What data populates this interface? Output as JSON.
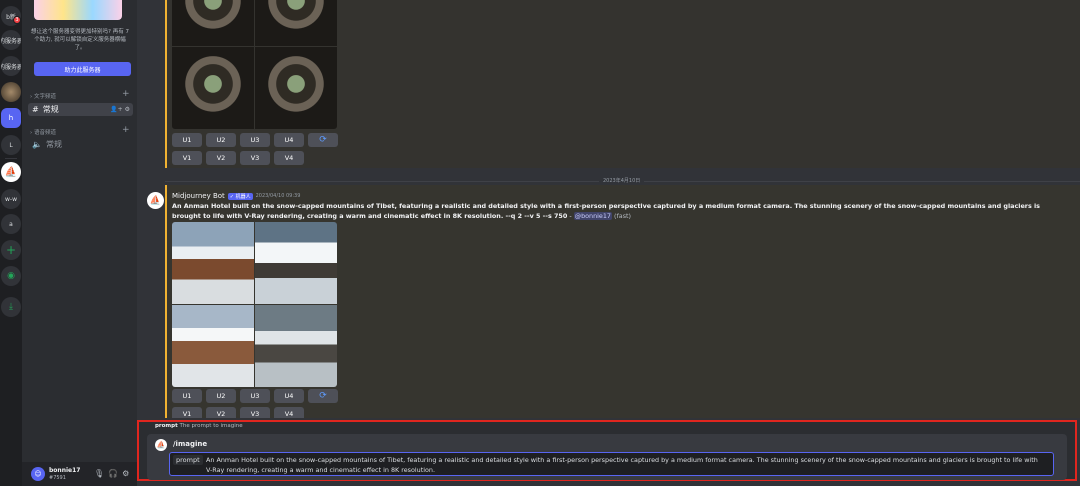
{
  "rail": {
    "servers": [
      "b新",
      "的服务器",
      "的服务器",
      "",
      "h",
      "L",
      "",
      "w-w",
      "a"
    ],
    "badge_count": "3",
    "add_icon": "+",
    "explore_icon": "◉",
    "download_icon": "⤓"
  },
  "sidebar": {
    "banner_text": "想让这个服务器变得更加特别吗? 再有 7 个助力, 就可以解锁自定义服务器横幅了。",
    "boost_button": "助力此服务器",
    "text_category": "文字频道",
    "voice_category": "语音频道",
    "text_channel": "常规",
    "voice_channel": "常规",
    "user": {
      "name": "bonnie17",
      "tag": "#7591"
    }
  },
  "first_message": {
    "upscale_buttons": [
      "U1",
      "U2",
      "U3",
      "U4"
    ],
    "variation_buttons": [
      "V1",
      "V2",
      "V3",
      "V4"
    ],
    "reroll_icon": "⟳"
  },
  "date_divider": "2023年4月10日",
  "bot_message": {
    "author": "Midjourney Bot",
    "bot_tag": "✓ 机器人",
    "timestamp": "2023/04/10 09:39",
    "prompt_bold": "An Anman Hotel built on the snow-capped mountains of Tibet, featuring a realistic and detailed style with a first-person perspective captured by a medium format camera. The stunning scenery of the snow-capped mountains and glaciers is brought to life with V-Ray rendering, creating a warm and cinematic effect in 8K resolution. --q 2 --v 5 --s 750",
    "separator": " - ",
    "mention": "@bonnie17",
    "mode": "(fast)",
    "upscale_buttons": [
      "U1",
      "U2",
      "U3",
      "U4"
    ],
    "variation_buttons": [
      "V1",
      "V2",
      "V3",
      "V4"
    ]
  },
  "command": {
    "hint_label": "prompt",
    "hint_text": "The prompt to imagine",
    "name": "/imagine",
    "field_label": "prompt",
    "field_value": "An Anman Hotel built on the snow-capped mountains of Tibet, featuring a realistic and detailed style with a first-person perspective captured by a medium format camera. The stunning scenery of the snow-capped mountains and glaciers is brought to life with V-Ray rendering, creating a warm and cinematic effect in 8K resolution."
  },
  "colors": {
    "accent": "#5865f2",
    "highlight_border": "#f0b232",
    "command_outline": "#e0261f"
  }
}
